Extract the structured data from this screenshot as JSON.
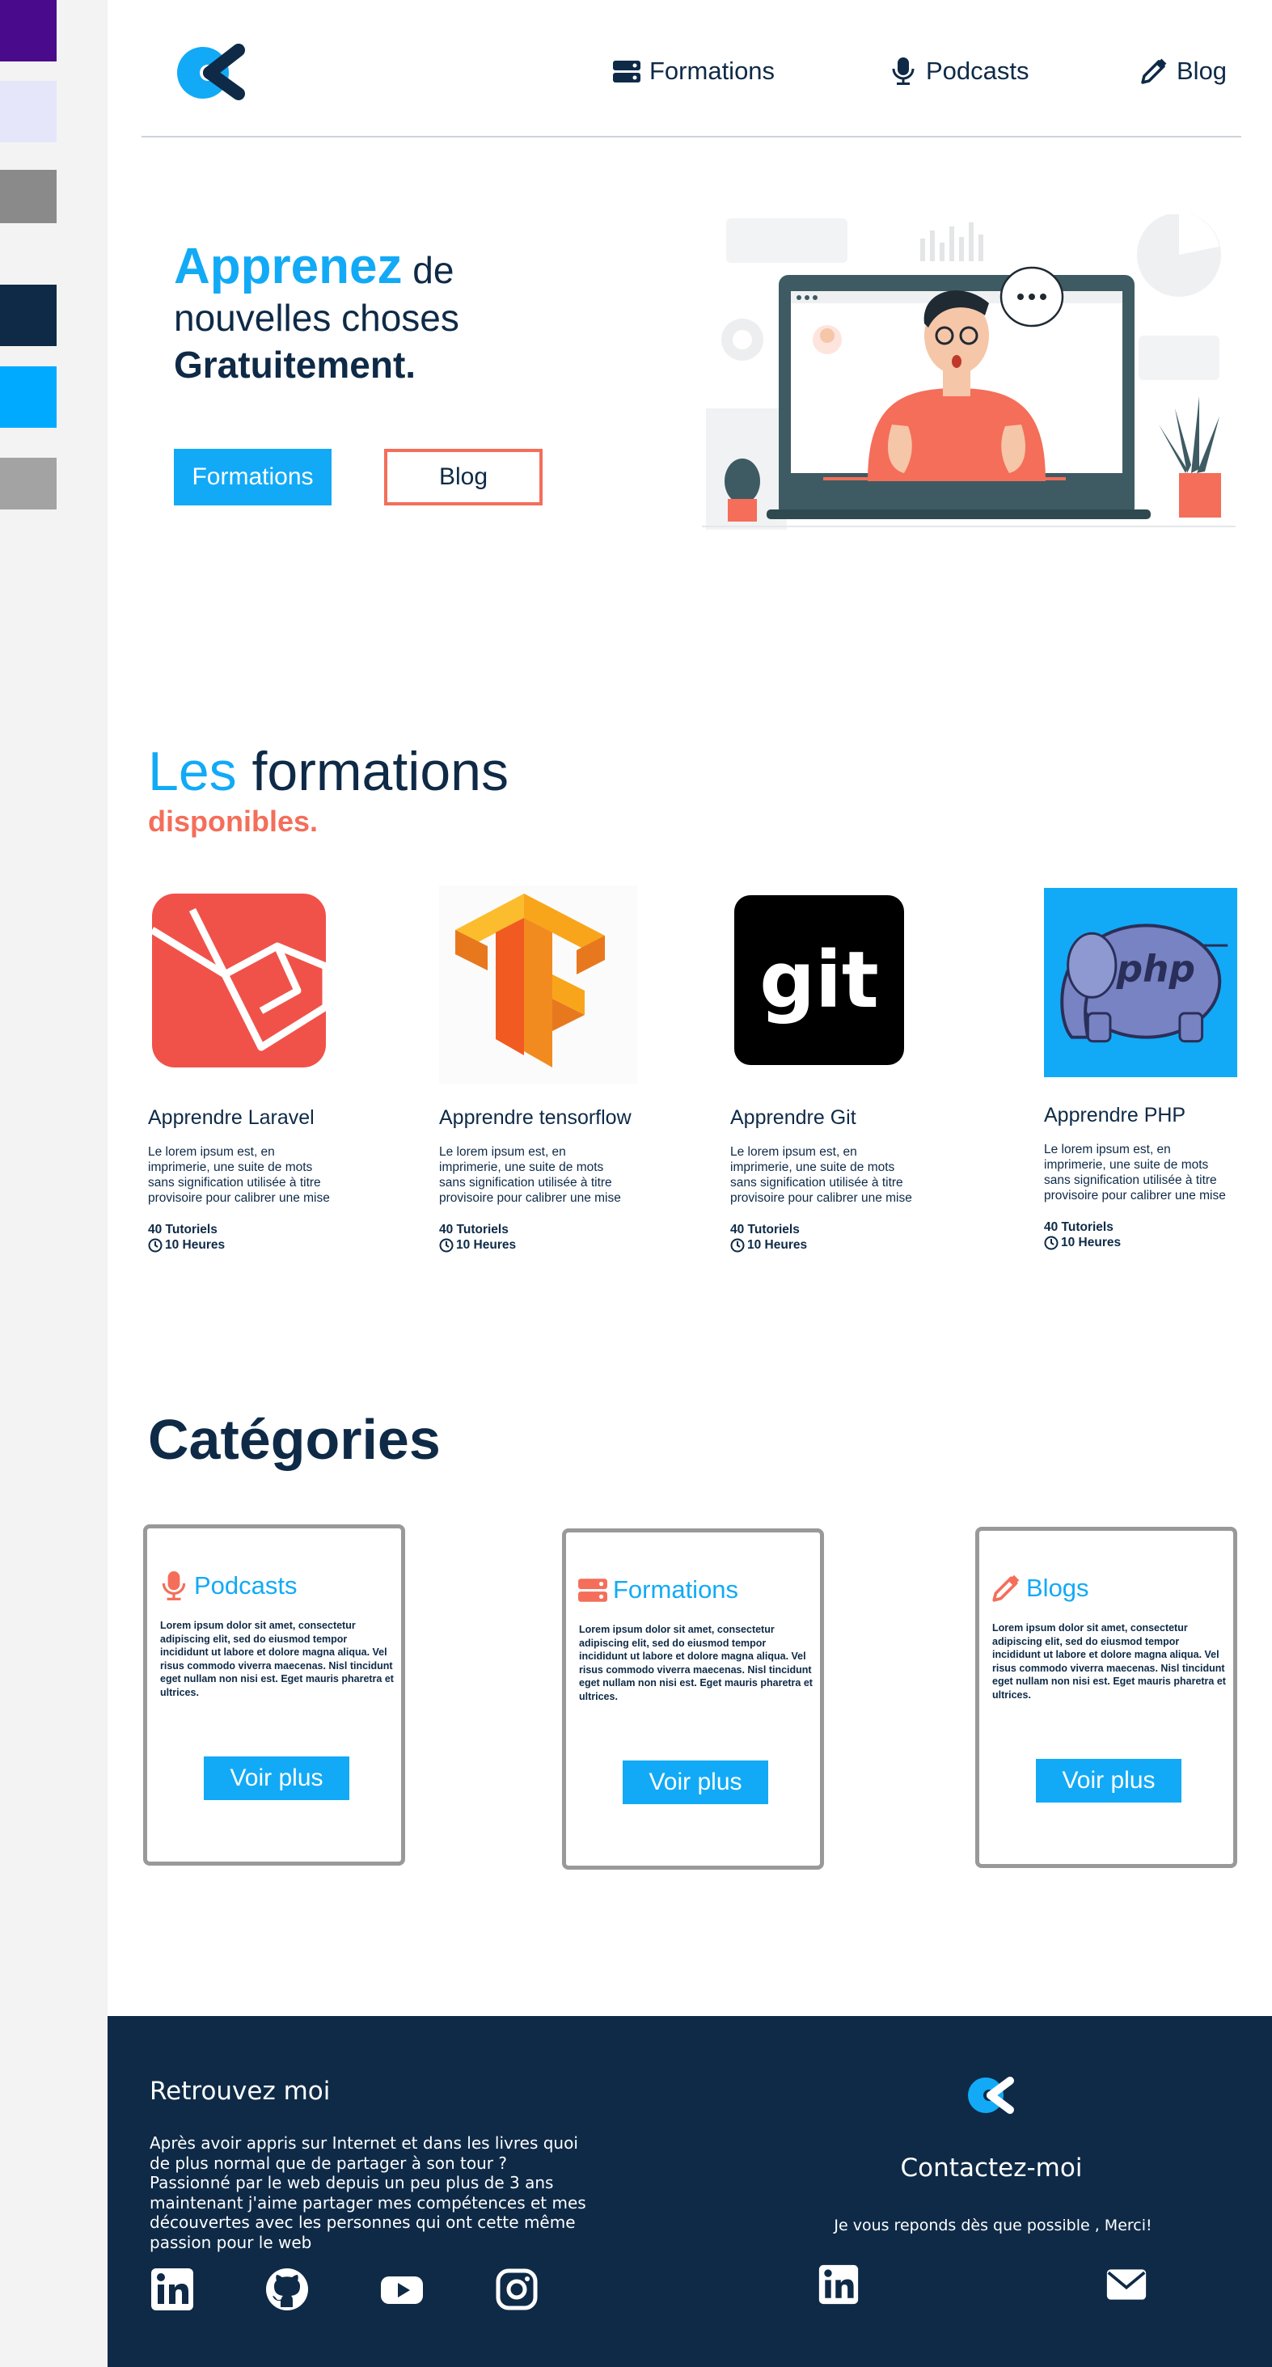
{
  "colors": {
    "swatches": [
      "#4a0a8c",
      "#e6e6fb",
      "#8a8a8a",
      "#0e2a47",
      "#00aaff",
      "#a3a3a3"
    ],
    "primary": "#12aaf6",
    "navy": "#0e2a47",
    "coral": "#f46e5a"
  },
  "header": {
    "nav": [
      {
        "label": "Formations",
        "icon": "server-icon"
      },
      {
        "label": "Podcasts",
        "icon": "microphone-icon"
      },
      {
        "label": "Blog",
        "icon": "pencil-icon"
      }
    ]
  },
  "hero": {
    "title_accent": "Apprenez",
    "title_rest": " de",
    "line2": "nouvelles choses",
    "line3": "Gratuitement.",
    "btn_primary": "Formations",
    "btn_secondary": "Blog"
  },
  "formations": {
    "title_accent": "Les",
    "title_rest": " formations",
    "subtitle": "disponibles.",
    "courses": [
      {
        "title": "Apprendre Laravel",
        "desc": "Le lorem ipsum est, en imprimerie, une suite de mots sans signification utilisée à titre provisoire pour calibrer une mise",
        "tutorials": "40 Tutoriels",
        "hours": "10 Heures",
        "logo": "laravel-logo"
      },
      {
        "title": "Apprendre tensorflow",
        "desc": "Le lorem ipsum est, en imprimerie, une suite de mots sans signification utilisée à titre provisoire pour calibrer une mise",
        "tutorials": "40 Tutoriels",
        "hours": "10 Heures",
        "logo": "tensorflow-logo"
      },
      {
        "title": "Apprendre Git",
        "desc": "Le lorem ipsum est, en imprimerie, une suite de mots sans signification utilisée à titre provisoire pour calibrer une mise",
        "tutorials": "40 Tutoriels",
        "hours": "10 Heures",
        "logo": "git-logo",
        "logo_text": "git"
      },
      {
        "title": "Apprendre PHP",
        "desc": "Le lorem ipsum est, en imprimerie, une suite de mots sans signification utilisée à titre provisoire pour calibrer une mise",
        "tutorials": "40 Tutoriels",
        "hours": "10 Heures",
        "logo": "php-elephant-logo",
        "logo_text": "php"
      }
    ]
  },
  "categories": {
    "title": "Catégories",
    "cards": [
      {
        "title": "Podcasts",
        "icon": "microphone-icon",
        "text": "Lorem ipsum dolor sit amet, consectetur adipiscing elit, sed do eiusmod tempor incididunt ut labore et dolore magna aliqua. Vel risus commodo viverra maecenas. Nisl tincidunt eget nullam non nisi est. Eget mauris pharetra et ultrices.",
        "button": "Voir plus"
      },
      {
        "title": "Formations",
        "icon": "server-icon",
        "text": "Lorem ipsum dolor sit amet, consectetur adipiscing elit, sed do eiusmod tempor incididunt ut labore et dolore magna aliqua. Vel risus commodo viverra maecenas. Nisl tincidunt eget nullam non nisi est. Eget mauris pharetra et ultrices.",
        "button": "Voir plus"
      },
      {
        "title": "Blogs",
        "icon": "pencil-icon",
        "text": "Lorem ipsum dolor sit amet, consectetur adipiscing elit, sed do eiusmod tempor incididunt ut labore et dolore magna aliqua. Vel risus commodo viverra maecenas. Nisl tincidunt eget nullam non nisi est. Eget mauris pharetra et ultrices.",
        "button": "Voir plus"
      }
    ]
  },
  "footer": {
    "title": "Retrouvez moi",
    "text": "Après avoir appris sur Internet et dans les livres quoi de plus normal que de partager à son tour ? Passionné par le web depuis un peu plus de 3 ans maintenant j'aime partager mes compétences et mes découvertes avec les personnes qui ont cette même passion pour le web",
    "socials": [
      "linkedin-icon",
      "github-icon",
      "youtube-icon",
      "instagram-icon"
    ],
    "contact_title": "Contactez-moi",
    "contact_text": "Je vous reponds dès que possible , Merci!",
    "contact_icons": [
      "linkedin-icon",
      "mail-icon"
    ]
  }
}
